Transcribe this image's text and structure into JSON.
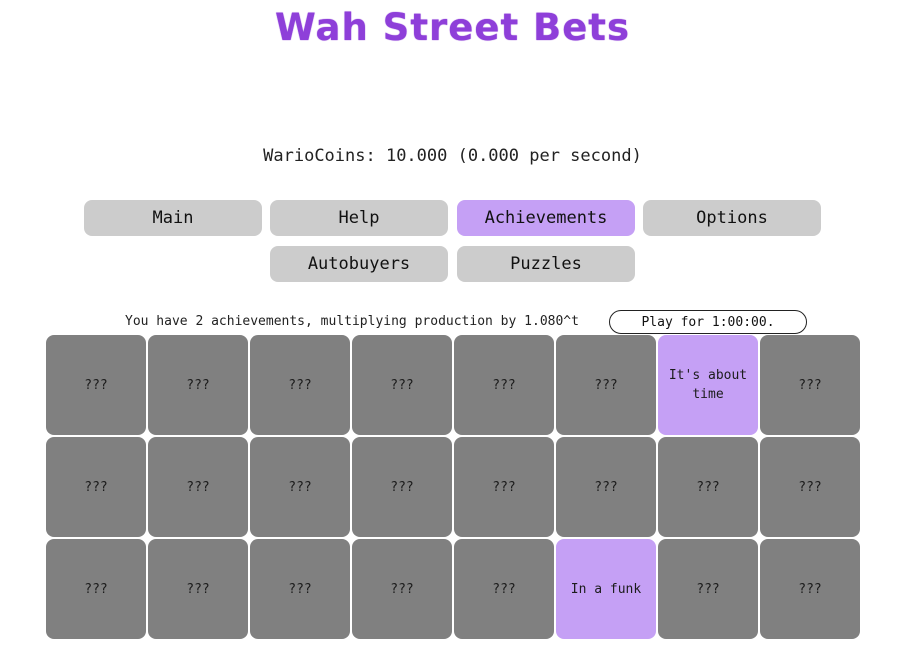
{
  "header": {
    "title": "Wah Street Bets",
    "coins_text": "WarioCoins: 10.000 (0.000 per second)"
  },
  "tabs": [
    {
      "label": "Main",
      "active": false
    },
    {
      "label": "Help",
      "active": false
    },
    {
      "label": "Achievements",
      "active": true
    },
    {
      "label": "Options",
      "active": false
    },
    {
      "label": "Autobuyers",
      "active": false
    },
    {
      "label": "Puzzles",
      "active": false
    }
  ],
  "achievements": {
    "summary": "You have 2 achievements, multiplying production by 1.080^t",
    "play_button": "Play for 1:00:00.",
    "colors": {
      "locked": "#808080",
      "unlocked": "#c5a0f5"
    },
    "cells": [
      {
        "label": "???",
        "unlocked": false
      },
      {
        "label": "???",
        "unlocked": false
      },
      {
        "label": "???",
        "unlocked": false
      },
      {
        "label": "???",
        "unlocked": false
      },
      {
        "label": "???",
        "unlocked": false
      },
      {
        "label": "???",
        "unlocked": false
      },
      {
        "label": "It's about time",
        "unlocked": true
      },
      {
        "label": "???",
        "unlocked": false
      },
      {
        "label": "???",
        "unlocked": false
      },
      {
        "label": "???",
        "unlocked": false
      },
      {
        "label": "???",
        "unlocked": false
      },
      {
        "label": "???",
        "unlocked": false
      },
      {
        "label": "???",
        "unlocked": false
      },
      {
        "label": "???",
        "unlocked": false
      },
      {
        "label": "???",
        "unlocked": false
      },
      {
        "label": "???",
        "unlocked": false
      },
      {
        "label": "???",
        "unlocked": false
      },
      {
        "label": "???",
        "unlocked": false
      },
      {
        "label": "???",
        "unlocked": false
      },
      {
        "label": "???",
        "unlocked": false
      },
      {
        "label": "???",
        "unlocked": false
      },
      {
        "label": "In a funk",
        "unlocked": true
      },
      {
        "label": "???",
        "unlocked": false
      },
      {
        "label": "???",
        "unlocked": false
      }
    ]
  }
}
